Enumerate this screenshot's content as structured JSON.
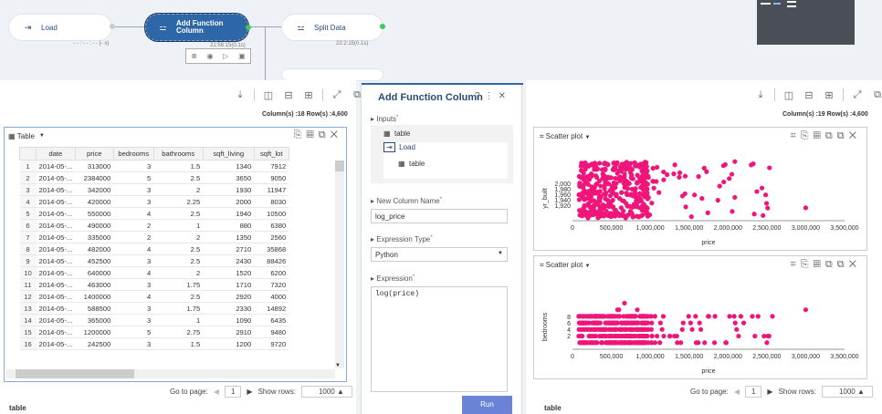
{
  "nodes": [
    {
      "label": "Load",
      "time": "- - : - - : - - (- s)"
    },
    {
      "label": "Add Function Column",
      "time": "21:58:15(0.1s)"
    },
    {
      "label": "Split Data",
      "time": "22:2:15(0.1s)"
    }
  ],
  "left_panel": {
    "colrow": "Column(s) :18   Row(s) :4,600",
    "table_title": "Table",
    "columns": [
      "",
      "date",
      "price",
      "bedrooms",
      "bathrooms",
      "sqft_living",
      "sqft_lot"
    ],
    "rows": [
      [
        "1",
        "2014-05-...",
        "313000",
        "3",
        "1.5",
        "1340",
        "7912"
      ],
      [
        "2",
        "2014-05-...",
        "2384000",
        "5",
        "2.5",
        "3650",
        "9050"
      ],
      [
        "3",
        "2014-05-...",
        "342000",
        "3",
        "2",
        "1930",
        "11947"
      ],
      [
        "4",
        "2014-05-...",
        "420000",
        "3",
        "2.25",
        "2000",
        "8030"
      ],
      [
        "5",
        "2014-05-...",
        "550000",
        "4",
        "2.5",
        "1940",
        "10500"
      ],
      [
        "6",
        "2014-05-...",
        "490000",
        "2",
        "1",
        "880",
        "6380"
      ],
      [
        "7",
        "2014-05-...",
        "335000",
        "2",
        "2",
        "1350",
        "2560"
      ],
      [
        "8",
        "2014-05-...",
        "482000",
        "4",
        "2.5",
        "2710",
        "35868"
      ],
      [
        "9",
        "2014-05-...",
        "452500",
        "3",
        "2.5",
        "2430",
        "88426"
      ],
      [
        "10",
        "2014-05-...",
        "640000",
        "4",
        "2",
        "1520",
        "6200"
      ],
      [
        "11",
        "2014-05-...",
        "463000",
        "3",
        "1.75",
        "1710",
        "7320"
      ],
      [
        "12",
        "2014-05-...",
        "1400000",
        "4",
        "2.5",
        "2920",
        "4000"
      ],
      [
        "13",
        "2014-05-...",
        "588500",
        "3",
        "1.75",
        "2330",
        "14892"
      ],
      [
        "14",
        "2014-05-...",
        "365000",
        "3",
        "1",
        "1090",
        "6435"
      ],
      [
        "15",
        "2014-05-...",
        "1200000",
        "5",
        "2.75",
        "2910",
        "9480"
      ],
      [
        "16",
        "2014-05-...",
        "242500",
        "3",
        "1.5",
        "1200",
        "9720"
      ]
    ],
    "go_to_page": "Go to page:",
    "page": "1",
    "show_rows": "Show rows:",
    "rows_count": "1000",
    "tab": "table"
  },
  "form": {
    "title": "Add Function Column",
    "inputs_label": "Inputs",
    "input_table": "table",
    "input_load": "Load",
    "input_sub_table": "table",
    "new_col_label": "New Column Name",
    "new_col_value": "log_price",
    "expr_type_label": "Expression Type",
    "expr_type_value": "Python",
    "expr_label": "Expression",
    "expr_value": "log(price)",
    "run": "Run"
  },
  "right_panel": {
    "colrow": "Column(s) :19   Row(s) :4,600",
    "plot1_title": "Scatter plot",
    "plot2_title": "Scatter plot",
    "go_to_page": "Go to page:",
    "page": "1",
    "show_rows": "Show rows:",
    "rows_count": "1000",
    "tab": "table"
  },
  "chart_data": [
    {
      "type": "scatter",
      "xlabel": "price",
      "ylabel": "yr_built",
      "x_ticks": [
        "0",
        "500,000",
        "1,000,000",
        "1,500,000",
        "2,000,000",
        "2,500,000",
        "3,000,000",
        "3,500,000"
      ],
      "y_ticks": [
        "2,000",
        "1,980",
        "1,960",
        "1,940",
        "1,920"
      ],
      "xlim": [
        0,
        3500000
      ],
      "ylim": [
        1900,
        2015
      ],
      "color": "#f0157a"
    },
    {
      "type": "scatter",
      "xlabel": "price",
      "ylabel": "bedrooms",
      "x_ticks": [
        "0",
        "500,000",
        "1,000,000",
        "1,500,000",
        "2,000,000",
        "2,500,000",
        "3,000,000",
        "3,500,000"
      ],
      "y_ticks": [
        "8",
        "6",
        "4",
        "2"
      ],
      "xlim": [
        0,
        3500000
      ],
      "ylim": [
        0,
        9
      ],
      "color": "#f0157a"
    }
  ]
}
